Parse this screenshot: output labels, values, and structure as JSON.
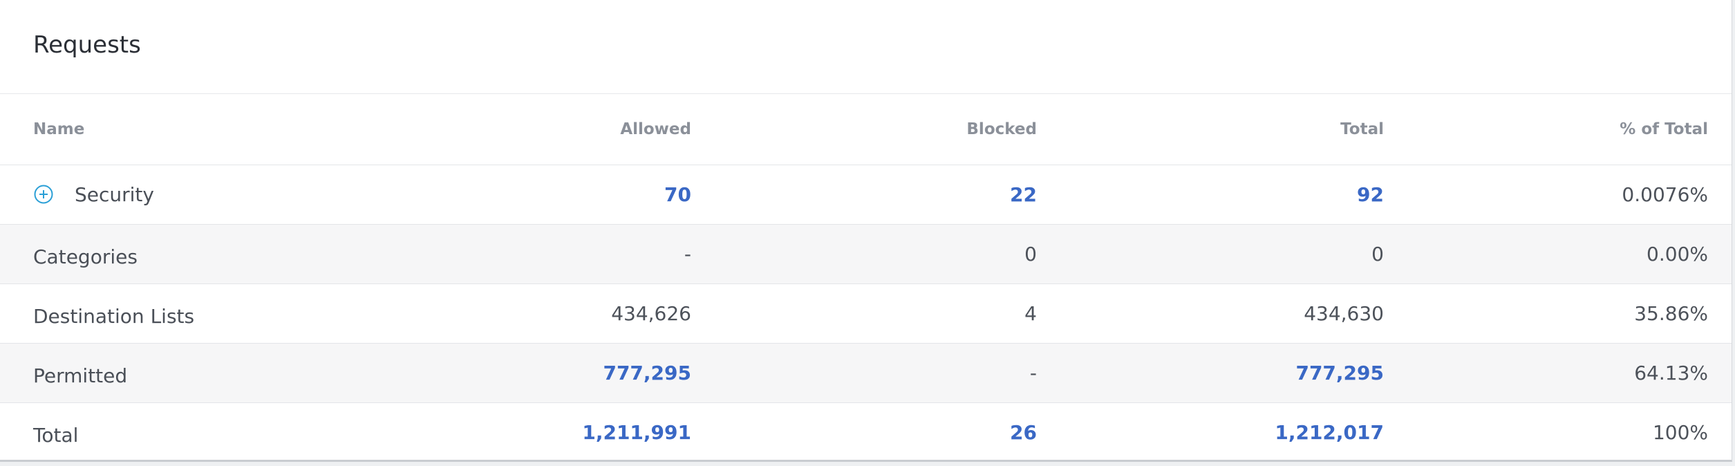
{
  "card": {
    "title": "Requests"
  },
  "table": {
    "headers": {
      "name": "Name",
      "allowed": "Allowed",
      "blocked": "Blocked",
      "total": "Total",
      "pct": "% of Total"
    },
    "rows": [
      {
        "name": "Security",
        "allowed": "70",
        "blocked": "22",
        "total": "92",
        "pct": "0.0076%",
        "expandable": true
      },
      {
        "name": "Categories",
        "allowed": "-",
        "blocked": "0",
        "total": "0",
        "pct": "0.00%"
      },
      {
        "name": "Destination Lists",
        "allowed": "434,626",
        "blocked": "4",
        "total": "434,630",
        "pct": "35.86%"
      },
      {
        "name": "Permitted",
        "allowed": "777,295",
        "blocked": "-",
        "total": "777,295",
        "pct": "64.13%"
      },
      {
        "name": "Total",
        "allowed": "1,211,991",
        "blocked": "26",
        "total": "1,212,017",
        "pct": "100%"
      }
    ]
  },
  "icons": {
    "expand": "plus-circle-icon"
  },
  "colors": {
    "link": "#3a68c5",
    "icon": "#2a9fd6",
    "shaded_row": "#f6f6f7"
  }
}
